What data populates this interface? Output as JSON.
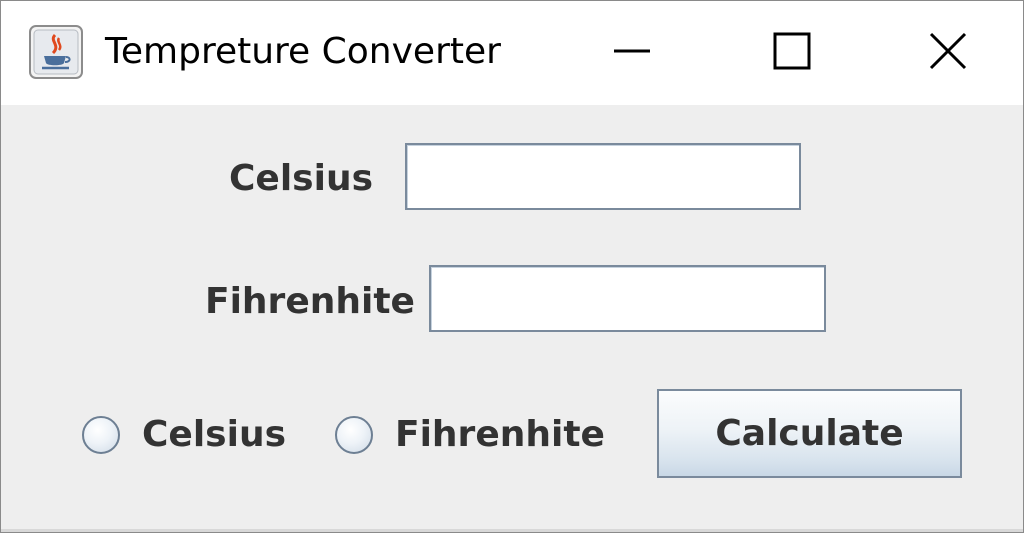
{
  "window": {
    "title": "Tempreture Converter",
    "controls": {
      "minimize_icon": "minimize-icon",
      "maximize_icon": "maximize-icon",
      "close_icon": "close-icon"
    }
  },
  "form": {
    "celsius_label": "Celsius",
    "celsius_value": "",
    "fahrenheit_label": "Fihrenhite",
    "fahrenheit_value": ""
  },
  "options": [
    {
      "label": "Celsius",
      "selected": false
    },
    {
      "label": "Fihrenhite",
      "selected": false
    }
  ],
  "actions": {
    "calculate_label": "Calculate"
  },
  "colors": {
    "window_bg": "#eeeeee",
    "titlebar_bg": "#ffffff",
    "label_text": "#333333",
    "field_border": "#7a8a9c"
  }
}
